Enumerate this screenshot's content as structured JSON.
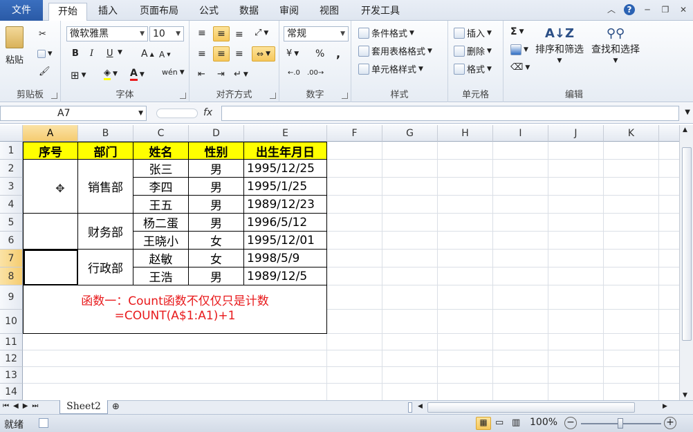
{
  "tabs": [
    "文件",
    "开始",
    "插入",
    "页面布局",
    "公式",
    "数据",
    "审阅",
    "视图",
    "开发工具"
  ],
  "ribbon": {
    "clipboard": {
      "label": "剪贴板",
      "paste": "粘贴"
    },
    "font": {
      "label": "字体",
      "name": "微软雅黑",
      "size": "10",
      "bold": "B",
      "italic": "I",
      "underline": "U"
    },
    "align": {
      "label": "对齐方式"
    },
    "number": {
      "label": "数字",
      "format": "常规",
      "percent": "%",
      "comma": ","
    },
    "styles": {
      "label": "样式",
      "cond": "条件格式",
      "table": "套用表格格式",
      "cell": "单元格样式"
    },
    "cells": {
      "label": "单元格",
      "insert": "插入",
      "delete": "删除",
      "format": "格式"
    },
    "edit": {
      "label": "编辑",
      "sigma": "Σ",
      "sort": "排序和筛选",
      "find": "查找和选择"
    }
  },
  "formula_bar": {
    "name_box": "A7",
    "fx": "fx",
    "value": ""
  },
  "columns": [
    "A",
    "B",
    "C",
    "D",
    "E",
    "F",
    "G",
    "H",
    "I",
    "J",
    "K"
  ],
  "rows": [
    "1",
    "2",
    "3",
    "4",
    "5",
    "6",
    "7",
    "8",
    "9",
    "10",
    "11",
    "12",
    "13",
    "14"
  ],
  "table": {
    "headers": [
      "序号",
      "部门",
      "姓名",
      "性别",
      "出生年月日"
    ],
    "departments": [
      "销售部",
      "财务部",
      "行政部"
    ],
    "records": [
      [
        "张三",
        "男",
        "1995/12/25"
      ],
      [
        "李四",
        "男",
        "1995/1/25"
      ],
      [
        "王五",
        "男",
        "1989/12/23"
      ],
      [
        "杨二蛋",
        "男",
        "1996/5/12"
      ],
      [
        "王晓小",
        "女",
        "1995/12/01"
      ],
      [
        "赵敏",
        "女",
        "1998/5/9"
      ],
      [
        "王浩",
        "男",
        "1989/12/5"
      ]
    ],
    "note_line1": "函数一：Count函数不仅仅只是计数",
    "note_line2": "=COUNT(A$1:A1)+1"
  },
  "sheet_tab": "Sheet2",
  "status": {
    "ready": "就绪",
    "zoom": "100%"
  },
  "colors": {
    "header_fill": "#ffff00",
    "note_text": "#e8191b",
    "file_tab": "#2b579a"
  }
}
